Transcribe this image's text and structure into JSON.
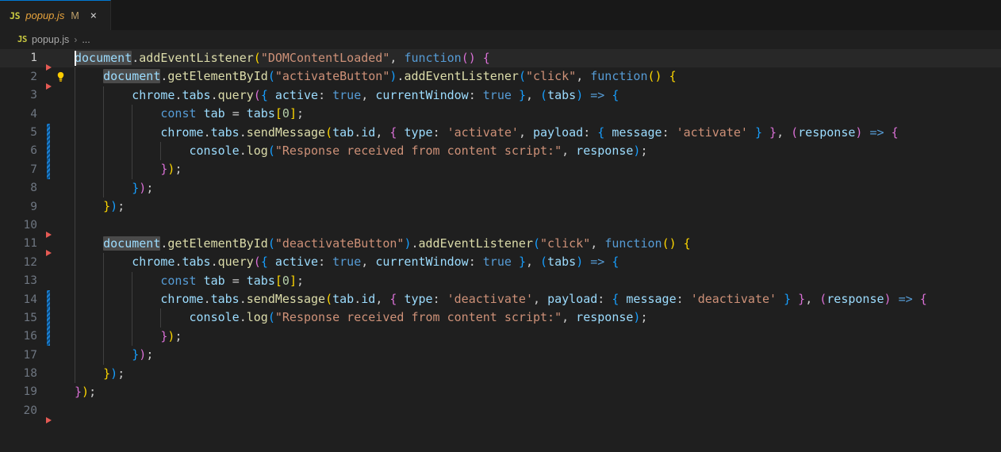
{
  "tab": {
    "file_icon": "js-file-icon",
    "label": "popup.js",
    "modified_badge": "M",
    "close_icon": "×"
  },
  "breadcrumb": {
    "file_icon": "js-file-icon",
    "file": "popup.js",
    "separator": "›",
    "ellipsis": "..."
  },
  "editor": {
    "language": "javascript",
    "total_lines": 20,
    "current_line": 1,
    "lines": [
      {
        "n": "1",
        "text": "document.addEventListener(\"DOMContentLoaded\", function() {"
      },
      {
        "n": "2",
        "text": "    document.getElementById(\"activateButton\").addEventListener(\"click\", function() {"
      },
      {
        "n": "3",
        "text": "        chrome.tabs.query({ active: true, currentWindow: true }, (tabs) => {"
      },
      {
        "n": "4",
        "text": "            const tab = tabs[0];"
      },
      {
        "n": "5",
        "text": "            chrome.tabs.sendMessage(tab.id, { type: 'activate', payload: { message: 'activate' } }, (response) => {"
      },
      {
        "n": "6",
        "text": "                console.log(\"Response received from content script:\", response);"
      },
      {
        "n": "7",
        "text": "            });"
      },
      {
        "n": "8",
        "text": "        });"
      },
      {
        "n": "9",
        "text": "    });"
      },
      {
        "n": "10",
        "text": ""
      },
      {
        "n": "11",
        "text": "    document.getElementById(\"deactivateButton\").addEventListener(\"click\", function() {"
      },
      {
        "n": "12",
        "text": "        chrome.tabs.query({ active: true, currentWindow: true }, (tabs) => {"
      },
      {
        "n": "13",
        "text": "            const tab = tabs[0];"
      },
      {
        "n": "14",
        "text": "            chrome.tabs.sendMessage(tab.id, { type: 'deactivate', payload: { message: 'deactivate' } }, (response) => {"
      },
      {
        "n": "15",
        "text": "                console.log(\"Response received from content script:\", response);"
      },
      {
        "n": "16",
        "text": "            });"
      },
      {
        "n": "17",
        "text": "        });"
      },
      {
        "n": "18",
        "text": "    });"
      },
      {
        "n": "19",
        "text": "});"
      },
      {
        "n": "20",
        "text": ""
      }
    ],
    "gutter_markers": {
      "modified_line_ranges": [
        [
          5,
          7
        ],
        [
          14,
          16
        ]
      ],
      "deleted_markers_after_lines": [
        1,
        2,
        10,
        11,
        20
      ]
    },
    "code_action_lightbulb_line": 2,
    "highlighted_symbol": "document",
    "highlighted_symbol_lines": [
      1,
      2,
      11
    ]
  },
  "colors": {
    "editor_background": "#1f1f1f",
    "tabbar_background": "#181818",
    "active_tab_border": "#0078d4",
    "current_line_background": "#282828",
    "line_number": "#6e7681",
    "string": "#ce9178",
    "keyword": "#569cd6",
    "function": "#dcdcaa",
    "variable": "#9cdcfe",
    "number": "#b5cea8",
    "bracket_level_1": "#ffd700",
    "bracket_level_2": "#da70d6",
    "bracket_level_3": "#179fff",
    "git_modified": "#1b81d4",
    "git_deleted": "#e55a54",
    "lightbulb": "#ffcc00"
  }
}
